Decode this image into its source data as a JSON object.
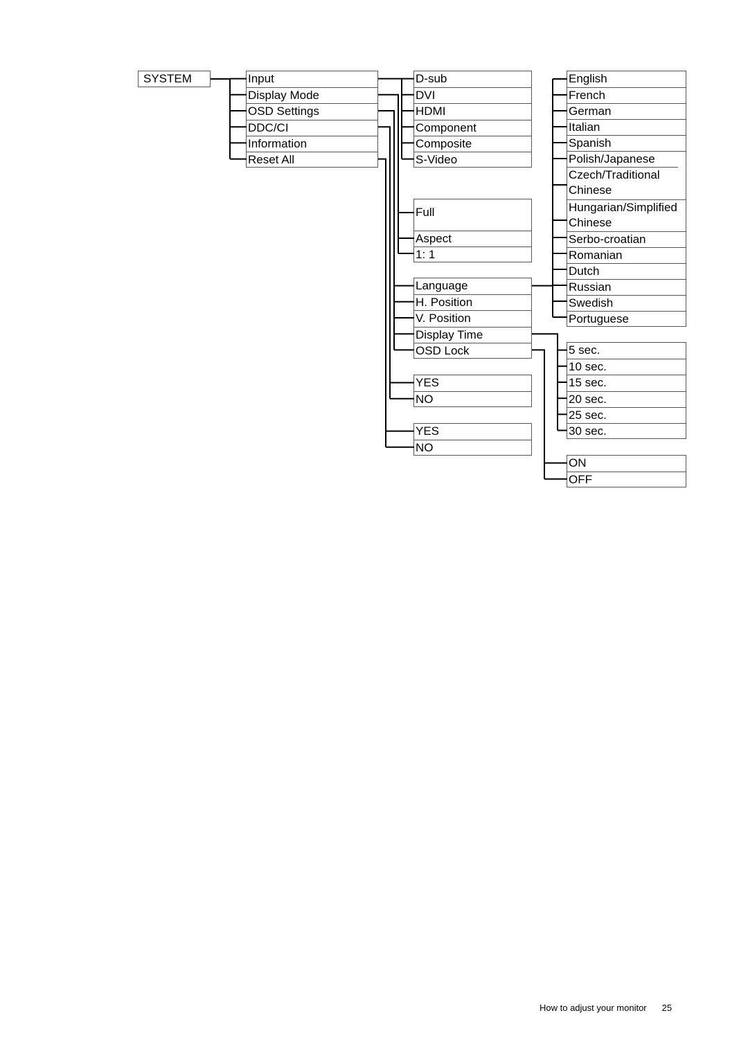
{
  "root": {
    "label": "SYSTEM"
  },
  "level1": [
    "Input",
    "Display Mode",
    "OSD Settings",
    "DDC/CI",
    "Information",
    "Reset All"
  ],
  "input_options": [
    "D-sub",
    "DVI",
    "HDMI",
    "Component",
    "Composite",
    "S-Video"
  ],
  "display_mode_options": [
    "Full",
    "Aspect",
    "1: 1"
  ],
  "osd_settings_options": [
    "Language",
    "H. Position",
    "V. Position",
    "Display Time",
    "OSD Lock"
  ],
  "ddcci_options": [
    "YES",
    "NO"
  ],
  "reset_all_options": [
    "YES",
    "NO"
  ],
  "language_options": [
    "English",
    "French",
    "German",
    "Italian",
    "Spanish",
    "Polish/Japanese",
    "Czech/Traditional Chinese",
    "Hungarian/Simplified Chinese",
    "Serbo-croatian",
    "Romanian",
    "Dutch",
    "Russian",
    "Swedish",
    "Portuguese"
  ],
  "display_time_options": [
    "5 sec.",
    "10 sec.",
    "15 sec.",
    "20 sec.",
    "25 sec.",
    "30 sec."
  ],
  "osd_lock_options": [
    "ON",
    "OFF"
  ],
  "footer": {
    "section": "How to adjust your monitor",
    "page": "25"
  }
}
